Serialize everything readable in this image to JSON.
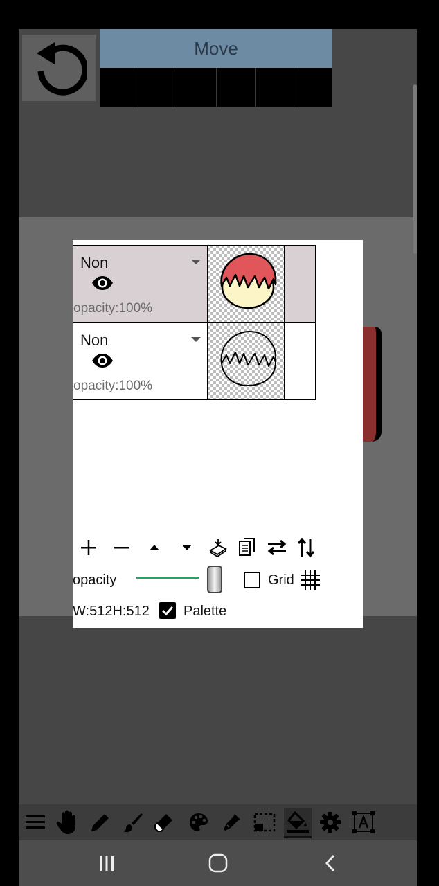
{
  "header": {
    "title": "Move",
    "frame_count": 6
  },
  "layers": [
    {
      "blend_mode": "Non",
      "opacity": "opacity:100%",
      "visible": true,
      "selected": true,
      "thumbnail": "colored-hair-drawing"
    },
    {
      "blend_mode": "Non",
      "opacity": "opacity:100%",
      "visible": true,
      "selected": false,
      "thumbnail": "lineart-hair-drawing"
    }
  ],
  "layer_toolbar": [
    "add-layer-icon",
    "remove-layer-icon",
    "move-layer-up-icon",
    "move-layer-down-icon",
    "merge-layer-icon",
    "copy-layer-icon",
    "swap-layer-icon",
    "sort-layer-icon"
  ],
  "controls": {
    "opacity_label": "opacity",
    "opacity_value": 1.0,
    "grid_label": "Grid",
    "grid_checked": false,
    "size_label": "W:512H:512",
    "palette_label": "Palette",
    "palette_checked": true
  },
  "bottom_toolbar": [
    "menu-icon",
    "hand-icon",
    "pencil-icon",
    "brush-icon",
    "eraser-icon",
    "palette-icon",
    "eyedropper-icon",
    "selection-icon",
    "fill-bucket-icon",
    "settings-icon",
    "text-icon"
  ],
  "active_tool": "fill-bucket-icon",
  "nav": [
    "recent-apps-icon",
    "home-icon",
    "back-icon"
  ],
  "colors": {
    "accent": "#6d8ba2",
    "selected_layer": "#d9d0d4",
    "slider": "#1fa861",
    "hair": "#e0565a"
  }
}
